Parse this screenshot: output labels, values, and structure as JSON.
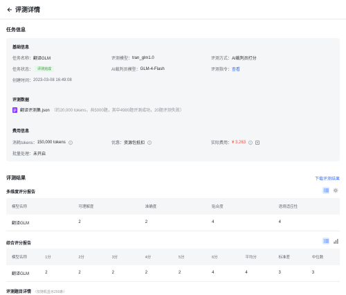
{
  "header": {
    "title": "评测详情"
  },
  "task_info": {
    "title": "任务信息",
    "basic": {
      "title": "基础信息",
      "task_name_label": "任务名称：",
      "task_name": "翻译GLM",
      "eval_model_label": "评测模型：",
      "eval_model": "tran_glm1.0",
      "eval_method_label": "评测方式：",
      "eval_method": "AI裁判员打分",
      "task_status_label": "任务状态：",
      "task_status": "评测完成",
      "judge_model_label": "AI裁判员模型：",
      "judge_model": "GLM-4-Flash",
      "eval_prompt_label": "评测指令：",
      "eval_prompt_link": "查看",
      "created_label": "创建时间：",
      "created_at": "2023-03-08 16:49:08"
    },
    "dataset": {
      "title": "评测数据",
      "file_name": "翻译评测集.json",
      "file_meta": "（约20,000 tokens，共5000题，其中4980题评测成功，20题评测失败）"
    },
    "cost": {
      "title": "费用信息",
      "tokens_label": "消耗tokens：",
      "tokens_value": "150,000 tokens",
      "discount_label": "优惠：",
      "discount_value": "资源包抵扣",
      "actual_label": "实际费用：",
      "actual_value": "¥ 3.263",
      "batch_label": "批量处理：",
      "batch_value": "未开启"
    }
  },
  "results": {
    "title": "评测结果",
    "download_label": "下载评测结果",
    "multi": {
      "title": "多维度评分报告",
      "headers": [
        "模型名称",
        "可理解度",
        "准确度",
        "贴合度",
        "语境适应性"
      ],
      "row": [
        "翻译GLM",
        "2",
        "2",
        "4",
        "4"
      ]
    },
    "overall": {
      "title": "综合评分报告",
      "headers": [
        "模型名称",
        "1分",
        "2分",
        "3分",
        "4分",
        "5分",
        "6分",
        "平均分",
        "标准差",
        "中位数"
      ],
      "row": [
        "翻译GLM",
        "2",
        "2",
        "2",
        "2",
        "2",
        "4",
        "4",
        "3",
        "3"
      ]
    },
    "details": {
      "title": "评测题目详情",
      "note": "（仅随机显示200条）"
    }
  }
}
